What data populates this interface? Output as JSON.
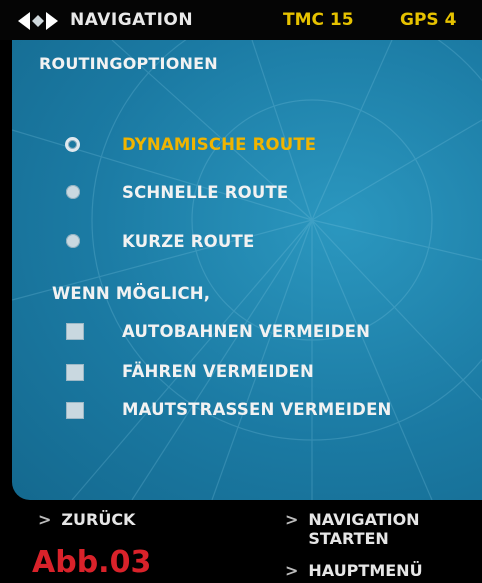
{
  "header": {
    "title": "NAVIGATION",
    "tmc": "TMC 15",
    "gps": "GPS 4"
  },
  "options": {
    "title": "ROUTINGOPTIONEN",
    "routes": [
      {
        "label": "DYNAMISCHE ROUTE",
        "selected": true
      },
      {
        "label": "SCHNELLE ROUTE",
        "selected": false
      },
      {
        "label": "KURZE ROUTE",
        "selected": false
      }
    ],
    "avoid_heading": "WENN MÖGLICH,",
    "avoid": [
      {
        "label": "AUTOBAHNEN VERMEIDEN",
        "checked": false
      },
      {
        "label": "FÄHREN VERMEIDEN",
        "checked": false
      },
      {
        "label": "MAUTSTRASSEN VERMEIDEN",
        "checked": false
      }
    ]
  },
  "footer": {
    "back": "ZURÜCK",
    "start_line1": "NAVIGATION",
    "start_line2": "STARTEN",
    "main_menu": "HAUPTMENÜ",
    "chevron": ">",
    "figure_label": "Abb.03"
  },
  "colors": {
    "accent_selected": "#f0b400",
    "status_yellow": "#e6c200",
    "panel_blue": "#1b7aa3",
    "figure_red": "#d9222a"
  },
  "icons": {
    "nav": "diamond-arrows-icon"
  }
}
